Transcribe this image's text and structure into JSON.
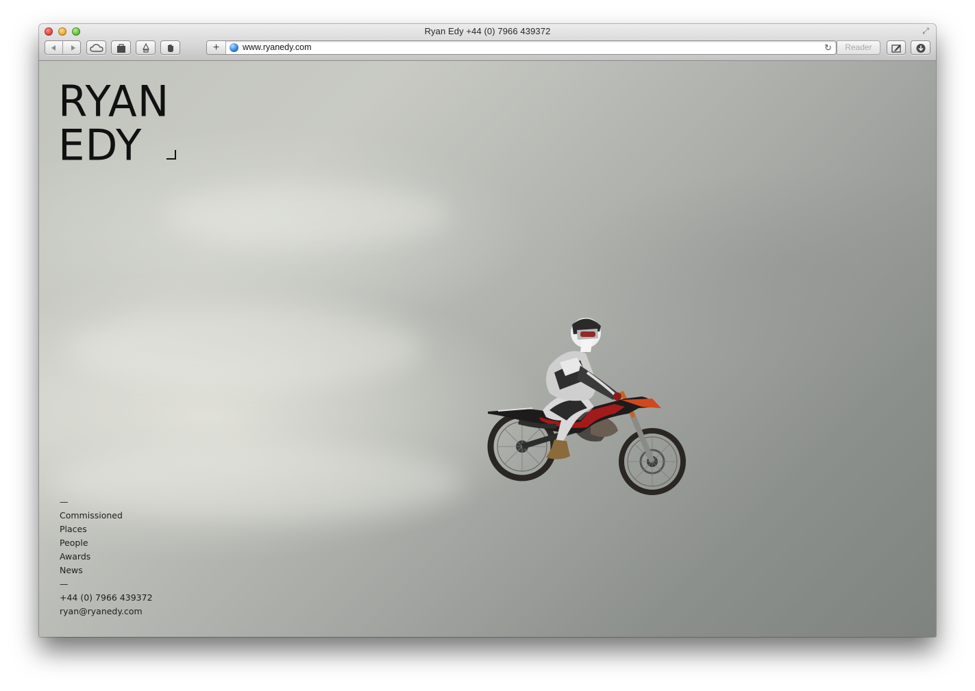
{
  "window": {
    "title": "Ryan Edy +44 (0) 7966 439372"
  },
  "toolbar": {
    "back_icon": "back-arrow-icon",
    "forward_icon": "forward-arrow-icon",
    "icloud_icon": "cloud-icon",
    "bag_icon": "shopping-bag-icon",
    "extension_icon": "extension-icon",
    "hand_icon": "hand-icon",
    "add_label": "+",
    "url": "www.ryanedy.com",
    "reload_label": "↻",
    "reader_label": "Reader"
  },
  "page": {
    "logo_line1": "RYAN",
    "logo_line2": "EDY",
    "nav": {
      "dash1": "—",
      "items": [
        "Commissioned",
        "Places",
        "People",
        "Awards",
        "News"
      ],
      "dash2": "—",
      "phone": "+44 (0) 7966 439372",
      "email": "ryan@ryanedy.com"
    }
  },
  "colors": {
    "text": "#1d1d1d",
    "sky_light": "#d9dbd5",
    "sky_dark": "#7f8380",
    "bike_orange": "#d2481e"
  }
}
